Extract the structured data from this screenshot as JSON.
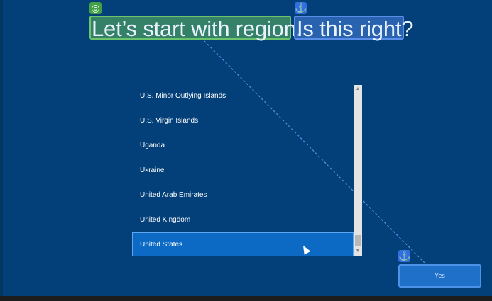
{
  "title": {
    "part1": "Let’s start with region.",
    "part2": "Is this right?"
  },
  "icons": {
    "badge_green": "◎",
    "badge_anchor": "⚓"
  },
  "regions": [
    {
      "label": "U.S. Minor Outlying Islands",
      "selected": false
    },
    {
      "label": "U.S. Virgin Islands",
      "selected": false
    },
    {
      "label": "Uganda",
      "selected": false
    },
    {
      "label": "Ukraine",
      "selected": false
    },
    {
      "label": "United Arab Emirates",
      "selected": false
    },
    {
      "label": "United Kingdom",
      "selected": false
    },
    {
      "label": "United States",
      "selected": true
    }
  ],
  "buttons": {
    "yes": "Yes"
  },
  "scrollbar": {
    "up_arrow": "▲",
    "down_arrow": "▼"
  },
  "colors": {
    "background": "#034079",
    "selected": "#0c6ac5",
    "annotation_green": "#6cc46d",
    "annotation_blue": "#5b8ee8"
  }
}
